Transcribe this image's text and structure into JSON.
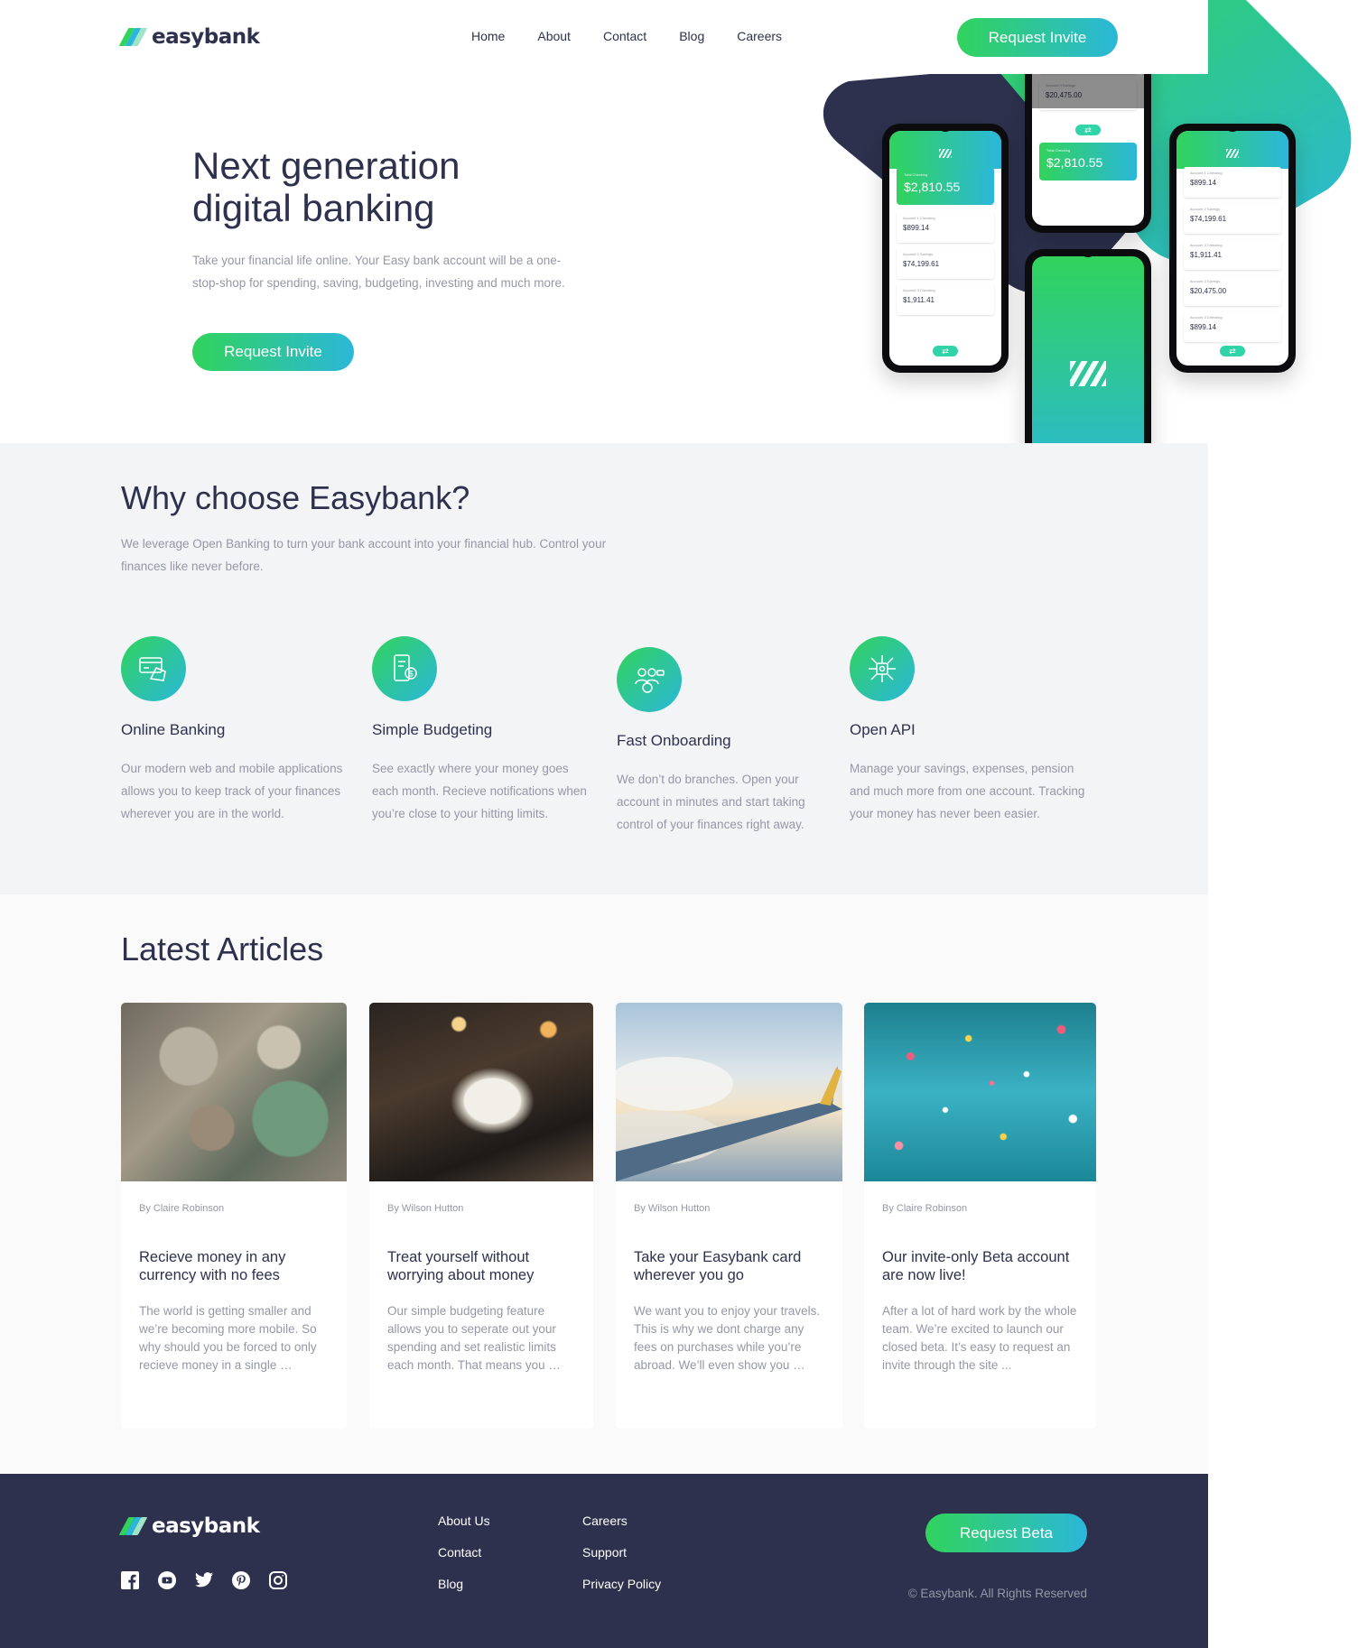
{
  "brand": {
    "name": "easybank"
  },
  "nav": {
    "items": [
      "Home",
      "About",
      "Contact",
      "Blog",
      "Careers"
    ]
  },
  "header": {
    "cta_label": "Request Invite"
  },
  "hero": {
    "title_line1": "Next generation",
    "title_line2": "digital banking",
    "description": "Take your financial life online. Your Easy bank account will be a one-stop-shop for spending, saving, budgeting, investing and much more.",
    "cta_label": "Request Invite"
  },
  "phones": {
    "total_label": "Total Checking",
    "total_value": "$2,810.55",
    "accounts": [
      {
        "label": "Account 1 Checking",
        "value": "$899.14"
      },
      {
        "label": "Account 2 Savings",
        "value": "$74,199.61"
      },
      {
        "label": "Account 3 Checking",
        "value": "$1,911.41"
      },
      {
        "label": "Account 3 Savings",
        "value": "$20,475.00"
      },
      {
        "label": "Account 3 Checking",
        "value": "$899.14"
      }
    ]
  },
  "why": {
    "title": "Why choose Easybank?",
    "description": "We leverage Open Banking to turn your bank account into your financial hub. Control your finances like never before.",
    "features": [
      {
        "icon": "online-banking-icon",
        "title": "Online Banking",
        "text": "Our modern web and mobile applications allows you to keep track of your finances wherever you are in the world."
      },
      {
        "icon": "budgeting-icon",
        "title": "Simple Budgeting",
        "text": "See exactly where your money goes each month. Recieve notifications when you’re close to your hitting limits."
      },
      {
        "icon": "onboarding-icon",
        "title": "Fast Onboarding",
        "text": "We don’t do branches. Open your account in minutes and start taking control of your finances right away."
      },
      {
        "icon": "api-icon",
        "title": "Open API",
        "text": "Manage your savings, expenses, pension and much more from one account. Tracking your money has never been easier."
      }
    ]
  },
  "articles": {
    "title": "Latest Articles",
    "items": [
      {
        "author": "By Claire Robinson",
        "title": "Recieve money in any currency with no fees",
        "excerpt": "The world is getting smaller and we’re becoming more mobile. So why should you be forced to only recieve money in a single …"
      },
      {
        "author": "By Wilson Hutton",
        "title": "Treat yourself without worrying about money",
        "excerpt": "Our simple budgeting feature allows you to seperate out your spending and set realistic limits each month. That means you …"
      },
      {
        "author": "By Wilson Hutton",
        "title": "Take your Easybank card wherever you go",
        "excerpt": "We want you to enjoy your travels. This is why we dont charge any fees on purchases while you’re abroad. We’ll even show you …"
      },
      {
        "author": "By Claire Robinson",
        "title": "Our invite-only Beta account are now live!",
        "excerpt": "After a lot of hard work by the whole team. We’re excited to launch our closed beta. It’s easy to request an invite through the site ..."
      }
    ]
  },
  "footer": {
    "col1": [
      "About Us",
      "Contact",
      "Blog"
    ],
    "col2": [
      "Careers",
      "Support",
      "Privacy Policy"
    ],
    "cta_label": "Request Beta",
    "copyright": "© Easybank. All Rights Reserved",
    "socials": [
      "facebook-icon",
      "youtube-icon",
      "twitter-icon",
      "pinterest-icon",
      "instagram-icon"
    ]
  },
  "colors": {
    "dark_blue": "#2d314d",
    "lime_green": "#31d35c",
    "bright_cyan": "#2bb7da",
    "grayish_blue": "#9597a7",
    "light_gray": "#f3f4f6"
  }
}
